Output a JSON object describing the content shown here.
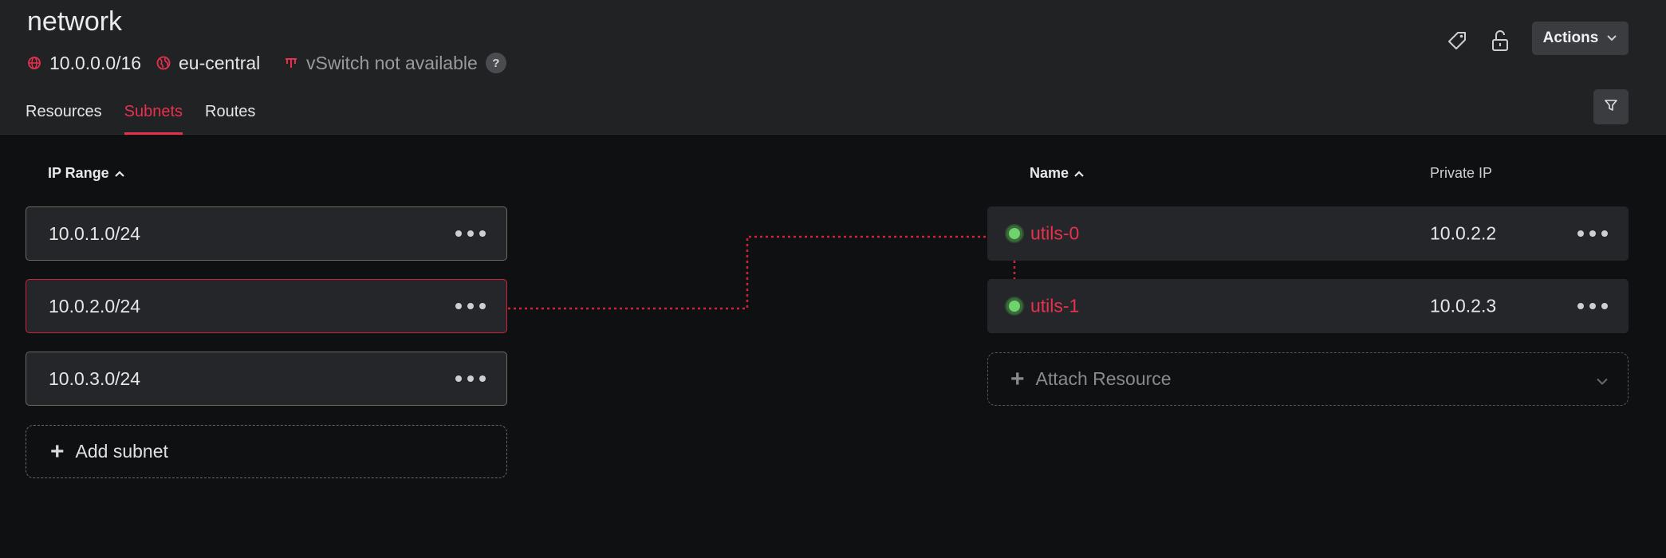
{
  "header": {
    "title": "network",
    "ip_range": "10.0.0.0/16",
    "location": "eu-central",
    "vswitch": "vSwitch not available",
    "help_label": "?",
    "actions_label": "Actions",
    "tabs": [
      {
        "label": "Resources",
        "active": false
      },
      {
        "label": "Subnets",
        "active": true
      },
      {
        "label": "Routes",
        "active": false
      }
    ]
  },
  "subnets": {
    "column_header": "IP Range",
    "items": [
      {
        "range": "10.0.1.0/24",
        "selected": false
      },
      {
        "range": "10.0.2.0/24",
        "selected": true
      },
      {
        "range": "10.0.3.0/24",
        "selected": false
      }
    ],
    "add_label": "Add subnet"
  },
  "resources": {
    "name_header": "Name",
    "ip_header": "Private IP",
    "items": [
      {
        "name": "utils-0",
        "ip": "10.0.2.2",
        "status": "running"
      },
      {
        "name": "utils-1",
        "ip": "10.0.2.3",
        "status": "running"
      }
    ],
    "attach_label": "Attach Resource"
  },
  "colors": {
    "accent": "#e8304f",
    "status_ok": "#6dd46b",
    "background": "#0f1012",
    "header_bg": "#202224",
    "card_bg": "#24262a"
  },
  "icons": {
    "ip": "globe-icon",
    "location": "location-icon",
    "vswitch": "vswitch-icon",
    "label": "tag-icon",
    "lock": "lock-open-icon",
    "filter": "filter-icon"
  }
}
